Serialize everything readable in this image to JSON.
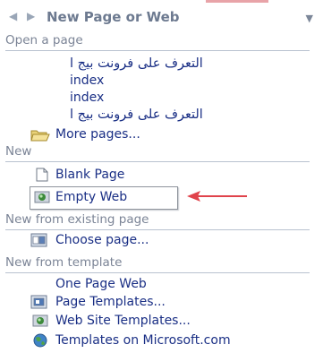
{
  "pane": {
    "title": "New Page or Web",
    "back_icon": "back-arrow-icon",
    "forward_icon": "forward-arrow-icon",
    "menu_icon": "dropdown-icon"
  },
  "open_a_page": {
    "heading": "Open a page",
    "items": [
      "التعرف على فرونت بيج ا",
      "index",
      "index",
      "التعرف على فرونت بيج ا"
    ],
    "more_pages_label": "More pages..."
  },
  "new": {
    "heading": "New",
    "blank_page_label": "Blank Page",
    "empty_web_label": "Empty Web"
  },
  "new_from_existing": {
    "heading": "New from existing page",
    "choose_page_label": "Choose page..."
  },
  "new_from_template": {
    "heading": "New from template",
    "one_page_web_label": "One Page Web",
    "page_templates_label": "Page Templates...",
    "web_site_templates_label": "Web Site Templates...",
    "templates_on_microsoft_label": "Templates on Microsoft.com"
  },
  "colors": {
    "link": "#1a2f85",
    "heading": "#7b8496",
    "annotation_arrow": "#e0434b"
  }
}
